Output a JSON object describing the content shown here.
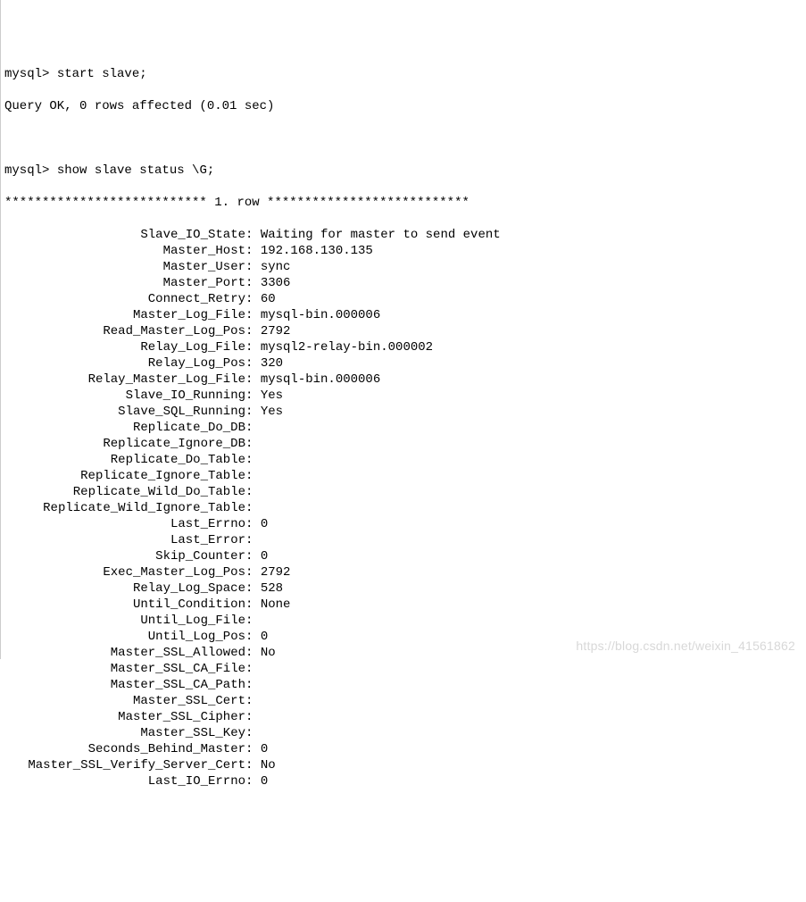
{
  "prompt1": "mysql> ",
  "cmd1": "start slave;",
  "result1": "Query OK, 0 rows affected (0.01 sec)",
  "prompt2": "mysql> ",
  "cmd2": "show slave status \\G;",
  "row_header": "*************************** 1. row ***************************",
  "status": [
    {
      "k": "Slave_IO_State",
      "v": "Waiting for master to send event"
    },
    {
      "k": "Master_Host",
      "v": "192.168.130.135"
    },
    {
      "k": "Master_User",
      "v": "sync"
    },
    {
      "k": "Master_Port",
      "v": "3306"
    },
    {
      "k": "Connect_Retry",
      "v": "60"
    },
    {
      "k": "Master_Log_File",
      "v": "mysql-bin.000006"
    },
    {
      "k": "Read_Master_Log_Pos",
      "v": "2792"
    },
    {
      "k": "Relay_Log_File",
      "v": "mysql2-relay-bin.000002"
    },
    {
      "k": "Relay_Log_Pos",
      "v": "320"
    },
    {
      "k": "Relay_Master_Log_File",
      "v": "mysql-bin.000006"
    },
    {
      "k": "Slave_IO_Running",
      "v": "Yes"
    },
    {
      "k": "Slave_SQL_Running",
      "v": "Yes"
    },
    {
      "k": "Replicate_Do_DB",
      "v": ""
    },
    {
      "k": "Replicate_Ignore_DB",
      "v": ""
    },
    {
      "k": "Replicate_Do_Table",
      "v": ""
    },
    {
      "k": "Replicate_Ignore_Table",
      "v": ""
    },
    {
      "k": "Replicate_Wild_Do_Table",
      "v": ""
    },
    {
      "k": "Replicate_Wild_Ignore_Table",
      "v": ""
    },
    {
      "k": "Last_Errno",
      "v": "0"
    },
    {
      "k": "Last_Error",
      "v": ""
    },
    {
      "k": "Skip_Counter",
      "v": "0"
    },
    {
      "k": "Exec_Master_Log_Pos",
      "v": "2792"
    },
    {
      "k": "Relay_Log_Space",
      "v": "528"
    },
    {
      "k": "Until_Condition",
      "v": "None"
    },
    {
      "k": "Until_Log_File",
      "v": ""
    },
    {
      "k": "Until_Log_Pos",
      "v": "0"
    },
    {
      "k": "Master_SSL_Allowed",
      "v": "No"
    },
    {
      "k": "Master_SSL_CA_File",
      "v": ""
    },
    {
      "k": "Master_SSL_CA_Path",
      "v": ""
    },
    {
      "k": "Master_SSL_Cert",
      "v": ""
    },
    {
      "k": "Master_SSL_Cipher",
      "v": ""
    },
    {
      "k": "Master_SSL_Key",
      "v": ""
    },
    {
      "k": "Seconds_Behind_Master",
      "v": "0"
    },
    {
      "k": "Master_SSL_Verify_Server_Cert",
      "v": "No"
    },
    {
      "k": "Last_IO_Errno",
      "v": "0"
    }
  ],
  "watermark": "https://blog.csdn.net/weixin_41561862"
}
